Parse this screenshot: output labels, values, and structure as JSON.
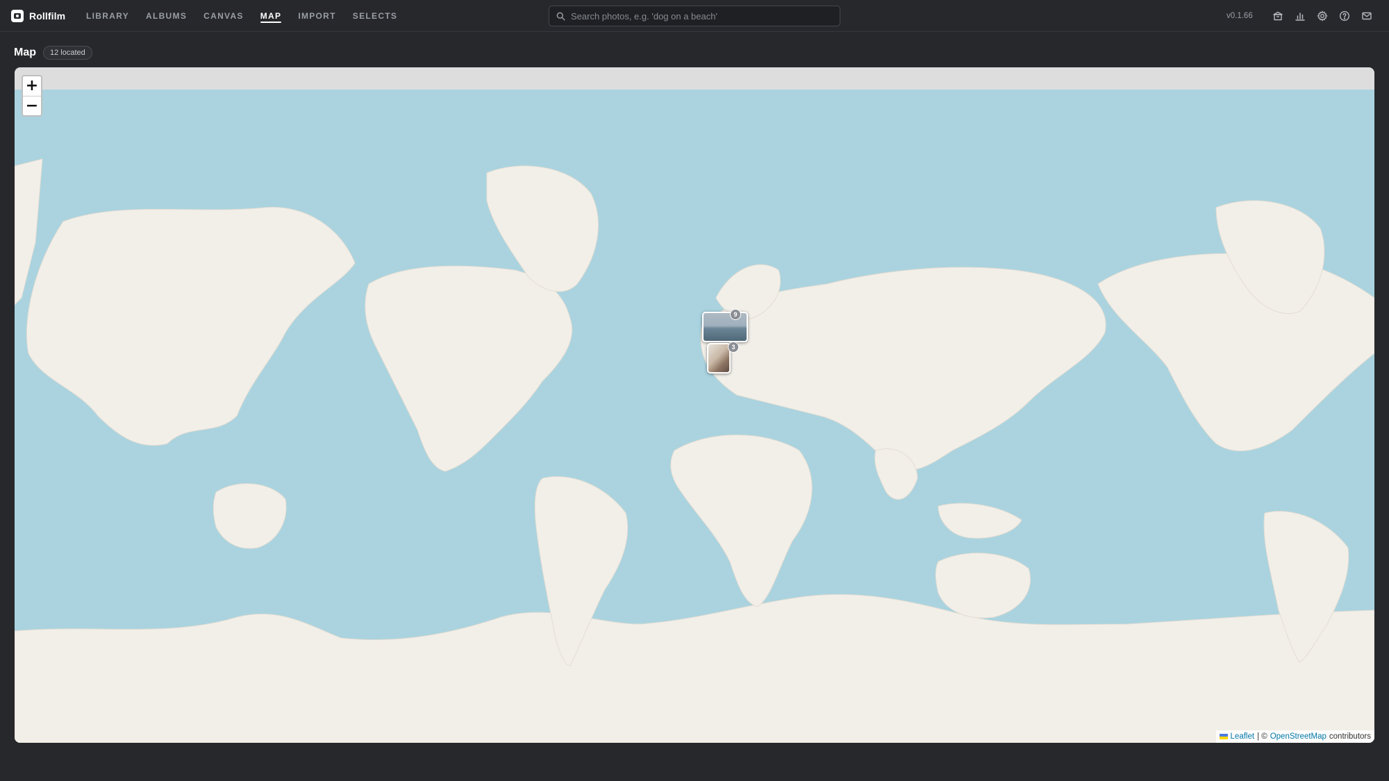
{
  "app": {
    "name": "Rollfilm",
    "version": "v0.1.66"
  },
  "nav": [
    {
      "label": "LIBRARY",
      "active": false
    },
    {
      "label": "ALBUMS",
      "active": false
    },
    {
      "label": "CANVAS",
      "active": false
    },
    {
      "label": "MAP",
      "active": true
    },
    {
      "label": "IMPORT",
      "active": false
    },
    {
      "label": "SELECTS",
      "active": false
    }
  ],
  "search": {
    "placeholder": "Search photos, e.g. 'dog on a beach'",
    "value": ""
  },
  "toolbar_icons": [
    "archive-icon",
    "stats-chart-icon",
    "settings-gear-icon",
    "help-icon",
    "mail-icon"
  ],
  "page": {
    "title": "Map",
    "located_badge": "12 located"
  },
  "map": {
    "zoom_in_label": "+",
    "zoom_out_label": "−",
    "clusters": [
      {
        "count": "9",
        "region": "Central Europe"
      },
      {
        "count": "3",
        "region": "Italy"
      }
    ],
    "attribution": {
      "leaflet": "Leaflet",
      "separator": "| ©",
      "osm": "OpenStreetMap",
      "suffix": "contributors"
    }
  },
  "colors": {
    "background": "#26282c",
    "ocean": "#aad3df",
    "land": "#f2efe9",
    "link": "#0078a8"
  }
}
